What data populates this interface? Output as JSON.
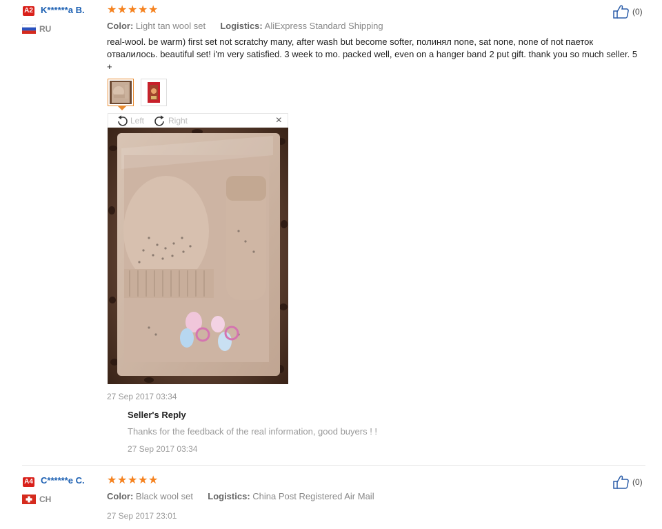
{
  "reviews": [
    {
      "level": "A2",
      "username": "K******a B.",
      "country": "RU",
      "stars": [
        "★",
        "★",
        "★",
        "★",
        "★"
      ],
      "helpful_count": "(0)",
      "color_label": "Color:",
      "color_value": "Light tan wool set",
      "logistics_label": "Logistics:",
      "logistics_value": "AliExpress Standard Shipping",
      "text": "real-wool. be warm) first set not scratchy many, after wash but become softer, полинял none, sat none, none of not паеток отвалилось. beautiful set! i'm very satisfied. 3 week to mo. packed well, even on a hanger band 2 put gift. thank you so much seller. 5 +",
      "viewer": {
        "rotate_left": "Left",
        "rotate_right": "Right",
        "close": "×"
      },
      "date": "27 Sep 2017 03:34",
      "seller_reply": {
        "title": "Seller's Reply",
        "text": "Thanks for the feedback of the real information, good buyers ! !",
        "date": "27 Sep 2017 03:34"
      }
    },
    {
      "level": "A4",
      "username": "C******e C.",
      "country": "CH",
      "stars": [
        "★",
        "★",
        "★",
        "★",
        "★"
      ],
      "helpful_count": "(0)",
      "color_label": "Color:",
      "color_value": "Black wool set",
      "logistics_label": "Logistics:",
      "logistics_value": "China Post Registered Air Mail",
      "date": "27 Sep 2017 23:01"
    }
  ],
  "colors": {
    "badge": "#d9201a",
    "username": "#1b5fb2",
    "stars": "#f5821f",
    "thumb_active": "#e88a2f"
  },
  "icons": [
    "flag-russia-icon",
    "flag-switzerland-icon",
    "thumbs-up-icon",
    "rotate-left-icon",
    "rotate-right-icon",
    "close-icon",
    "star-icon"
  ]
}
